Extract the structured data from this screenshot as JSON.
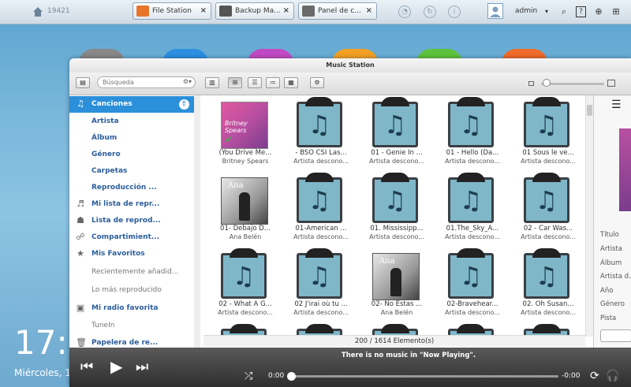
{
  "topbar": {
    "host": "19421",
    "tabs": [
      {
        "label": "File Station",
        "icon": "folder-icon",
        "color": "#e8742c"
      },
      {
        "label": "Backup Ma...",
        "icon": "backup-icon",
        "color": "#555555"
      },
      {
        "label": "Panel de c...",
        "icon": "control-panel-icon",
        "color": "#6a6a6a"
      }
    ],
    "user": "admin"
  },
  "desktop": {
    "clock": "17:",
    "date": "Miércoles, 1"
  },
  "window": {
    "title": "Music Station",
    "search_placeholder": "Búsqueda"
  },
  "sidebar": {
    "items": [
      {
        "label": "Canciones",
        "icon": "music-note-icon"
      },
      {
        "label": "Artista"
      },
      {
        "label": "Álbum"
      },
      {
        "label": "Género"
      },
      {
        "label": "Carpetas"
      },
      {
        "label": "Reproducción ..."
      },
      {
        "label": "Mi lista de repr...",
        "icon": "playlist-icon"
      },
      {
        "label": "Lista de reprod...",
        "icon": "users-icon"
      },
      {
        "label": "Compartimient...",
        "icon": "share-icon"
      },
      {
        "label": "Mis Favoritos",
        "icon": "star-icon"
      },
      {
        "label": "Recientemente añadid..."
      },
      {
        "label": "Lo más reproducido"
      },
      {
        "label": "Mi radio favorita",
        "icon": "radio-icon"
      },
      {
        "label": "TuneIn"
      },
      {
        "label": "Papelera de re...",
        "icon": "trash-icon"
      }
    ]
  },
  "songs": [
    {
      "title": "(You Drive Me...",
      "artist": "Britney Spears",
      "cover": "britney"
    },
    {
      "title": "- BSO CSI Las...",
      "artist": "Artista descono...",
      "cover": "generic"
    },
    {
      "title": "01 - Genie In ...",
      "artist": "Artista descono...",
      "cover": "generic"
    },
    {
      "title": "01 - Hello (Da...",
      "artist": "Artista descono...",
      "cover": "generic"
    },
    {
      "title": "01 Sous le ve...",
      "artist": "Artista descono...",
      "cover": "generic"
    },
    {
      "title": "01- Debajo D...",
      "artist": "Ana Belén",
      "cover": "ana"
    },
    {
      "title": "01-American ...",
      "artist": "Artista descono...",
      "cover": "generic"
    },
    {
      "title": "01. Mississipp...",
      "artist": "Artista descono...",
      "cover": "generic"
    },
    {
      "title": "01.The_Sky_A...",
      "artist": "Artista descono...",
      "cover": "generic"
    },
    {
      "title": "02 - Car Was...",
      "artist": "Artista descono...",
      "cover": "generic"
    },
    {
      "title": "02 - What A G...",
      "artist": "Artista descono...",
      "cover": "generic"
    },
    {
      "title": "02 J'irai où tu ...",
      "artist": "Artista descono...",
      "cover": "generic"
    },
    {
      "title": "02- No Estas ...",
      "artist": "Ana Belén",
      "cover": "ana"
    },
    {
      "title": "02-Bravehear...",
      "artist": "Artista descono...",
      "cover": "generic"
    },
    {
      "title": "02. Oh Susan...",
      "artist": "Artista descono...",
      "cover": "generic"
    }
  ],
  "cover_text": {
    "britney": "Britney Spears",
    "ana": "Ana"
  },
  "status": "200 / 1614 Elemento(s)",
  "info_panel": {
    "fields": [
      "Título",
      "Artista",
      "Álbum",
      "Artista d...",
      "Año",
      "Género",
      "Pista"
    ]
  },
  "player": {
    "now_playing": "There is no music in \"Now Playing\".",
    "time_start": "0:00",
    "time_end": "-0:00",
    "progress": 0
  },
  "colors": {
    "accent": "#2b8fd9",
    "sidebar_link": "#2a5d9a"
  }
}
